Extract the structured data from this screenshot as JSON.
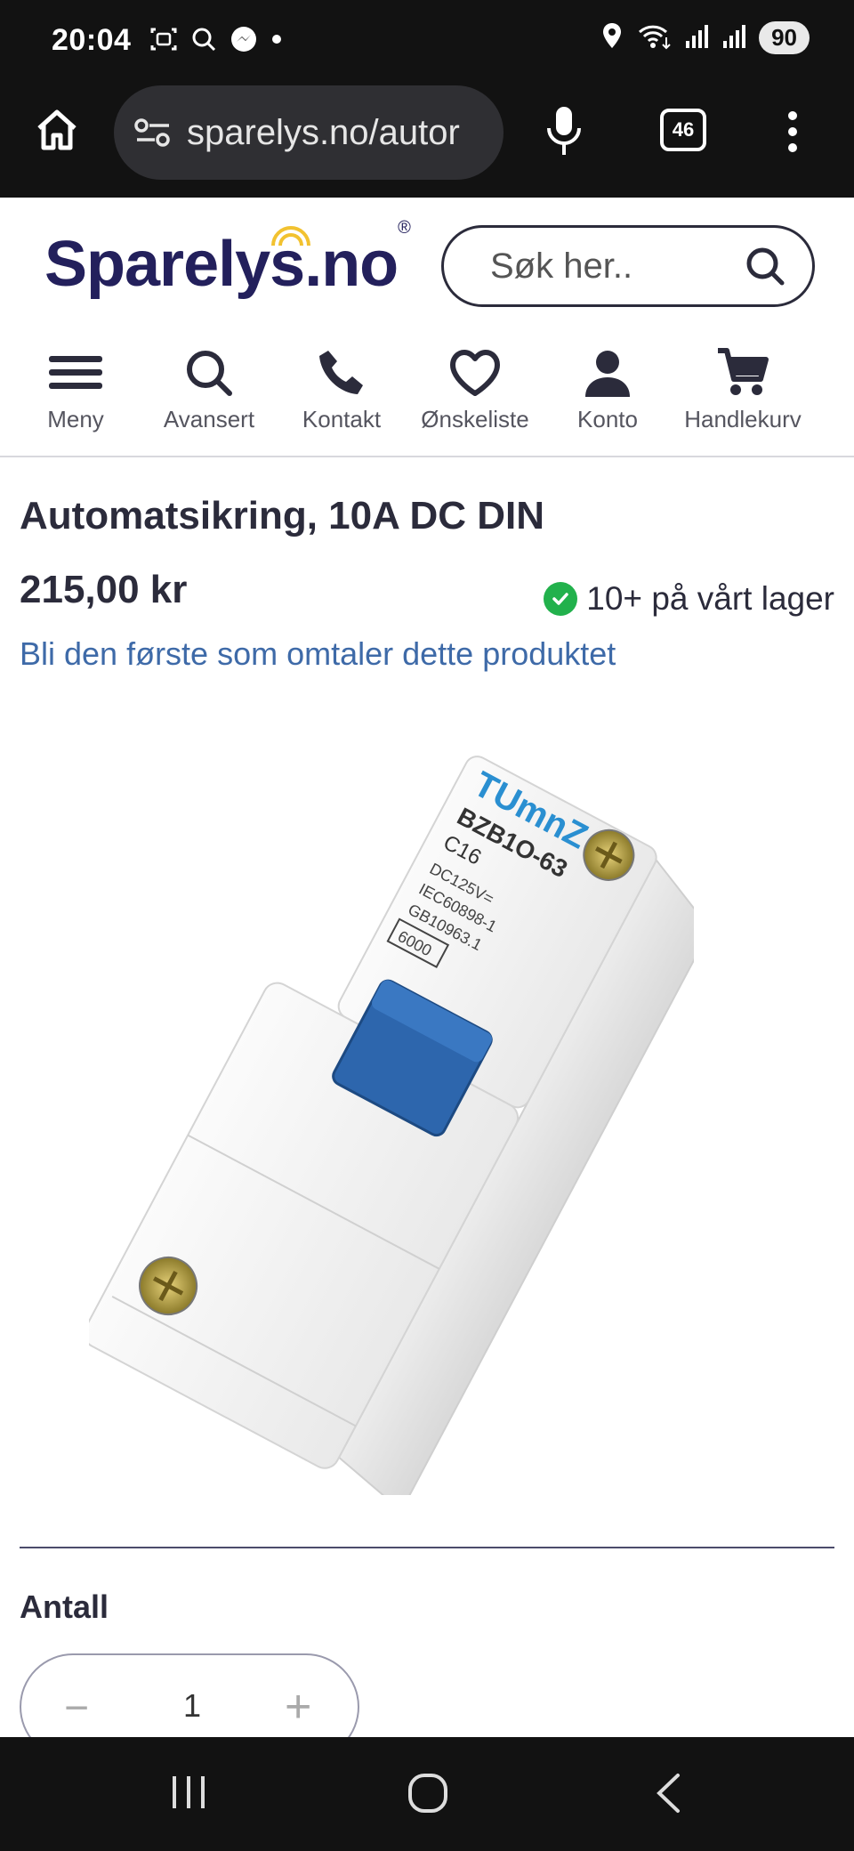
{
  "status_bar": {
    "time": "20:04",
    "battery": "90",
    "left_icons": [
      "screenshot-icon",
      "search-icon",
      "messenger-icon",
      "dot-icon"
    ],
    "right_icons": [
      "location-icon",
      "wifi-icon",
      "signal-icon",
      "signal-icon"
    ]
  },
  "browser": {
    "url": "sparelys.no/autor",
    "tab_count": "46"
  },
  "site": {
    "logo_text": "Sparelys.no",
    "logo_mark": "®",
    "search_placeholder": "Søk her..",
    "nav": [
      {
        "label": "Meny",
        "icon": "hamburger-icon"
      },
      {
        "label": "Avansert",
        "icon": "search-icon"
      },
      {
        "label": "Kontakt",
        "icon": "phone-icon"
      },
      {
        "label": "Ønskeliste",
        "icon": "heart-icon"
      },
      {
        "label": "Konto",
        "icon": "user-icon"
      },
      {
        "label": "Handlekurv",
        "icon": "cart-icon"
      }
    ]
  },
  "product": {
    "title": "Automatsikring, 10A DC DIN",
    "price": "215,00 kr",
    "stock": "10+ på vårt lager",
    "review_link": "Bli den første som omtaler dette produktet",
    "image_text": {
      "brand": "TUmnZ",
      "model": "BZB1O-63",
      "rating": "C16",
      "voltage": "DC125V=",
      "standard1": "IEC60898-1",
      "standard2": "GB10963.1",
      "capacity": "6000"
    }
  },
  "quantity": {
    "label": "Antall",
    "value": "1",
    "minus": "−",
    "plus": "+"
  },
  "colors": {
    "brand_navy": "#23205c",
    "link_blue": "#3e6aa8",
    "stock_green": "#22b14c",
    "breaker_blue": "#2d66ad"
  }
}
